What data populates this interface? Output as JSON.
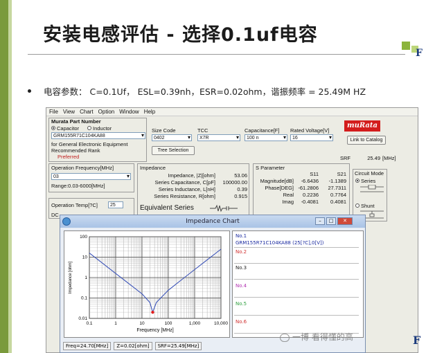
{
  "slide": {
    "title": "安装电感评估 - 选择0.1uf电容",
    "bullet": "电容参数：  C=0.1Uf， ESL=0.39nh，ESR=0.02ohm，谐振频率 = 25.49M HZ",
    "corner_logo": "F",
    "watermark": "一博  看得懂的高",
    "bottom_logo": "F"
  },
  "colors": {
    "accent_green": "#7a9a3c",
    "murata_red": "#d31c1c",
    "curve_blue": "#3a52b8",
    "marker_red": "#e02020"
  },
  "app": {
    "menu": [
      "File",
      "View",
      "Chart",
      "Option",
      "Window",
      "Help"
    ],
    "part_number": {
      "label": "Murata Part Number",
      "radio_capacitor": "Capacitor",
      "radio_inductor": "Inductor",
      "value": "GRM155R71C104KA88",
      "note1": "for General Electronic Equipment",
      "note2": "Recommended Rank",
      "note3": "Preferred"
    },
    "size_code": {
      "label": "Size Code",
      "value": "0402"
    },
    "tcc": {
      "label": "TCC",
      "value": "X7R"
    },
    "capacitance": {
      "label": "Capacitance[F]",
      "value": "100 n"
    },
    "rated_voltage": {
      "label": "Rated Voltage[V]",
      "value": "16"
    },
    "tree_button": "Tree Selection",
    "catalog_button": "Link to Catalog",
    "brand_logo": "muRata",
    "srf": {
      "label": "SRF",
      "value": "25.49",
      "unit": "[MHz]"
    },
    "operation_frequency": {
      "label": "Operation Frequency[MHz]",
      "value": "03",
      "range": "Range:0.03-6000[MHz]"
    },
    "operation_temp": {
      "label": "Operation Temp[?C]",
      "value": "25"
    },
    "dc_label": "DC",
    "impedance": {
      "label": "Impedance",
      "rows": [
        {
          "name": "Impedance, |Z|[ohm]",
          "value": "53.06"
        },
        {
          "name": "Series Capacitance, C[pF]",
          "value": "100000.00"
        },
        {
          "name": "Series Inductance, L[nH]",
          "value": "0.39"
        },
        {
          "name": "Series Resistance, R[ohm]",
          "value": "0.915"
        }
      ],
      "equivalent": "Equivalent Series"
    },
    "sparam": {
      "label": "S Parameter",
      "col1": "S11",
      "col2": "S21",
      "rows": [
        {
          "name": "Magnitude[dB]",
          "s11": "-6.6436",
          "s21": "-1.1389"
        },
        {
          "name": "Phase[DEG]",
          "s11": "-61.2806",
          "s21": "27.7311"
        },
        {
          "name": "Real",
          "s11": "0.2236",
          "s21": "0.7764"
        },
        {
          "name": "Imag",
          "s11": "-0.4081",
          "s21": "0.4081"
        }
      ]
    },
    "circuit_mode": {
      "label": "Circuit Mode",
      "series": "Series",
      "shunt": "Shunt"
    }
  },
  "impedance_chart": {
    "window_title": "Impedance Chart",
    "slots": [
      {
        "label": "No.1",
        "detail": "GRM155R71C104KA88 (25[?C],0[V])",
        "color": "#1a2aa0"
      },
      {
        "label": "No.2",
        "detail": "",
        "color": "#d03030"
      },
      {
        "label": "No.3",
        "detail": "",
        "color": "#222222"
      },
      {
        "label": "No.4",
        "detail": "",
        "color": "#b030b0"
      },
      {
        "label": "No.5",
        "detail": "",
        "color": "#30a040"
      },
      {
        "label": "No.6",
        "detail": "",
        "color": "#d03030"
      }
    ],
    "status": [
      "Freq=24.70[MHz]",
      "Z=0.02[ohm]",
      "SRF=25.49[MHz]"
    ]
  },
  "chart_data": {
    "type": "line",
    "xlabel": "Frequency [MHz]",
    "ylabel": "Impedance [ohm]",
    "xscale": "log",
    "yscale": "log",
    "xlim": [
      0.1,
      10000
    ],
    "ylim": [
      0.01,
      100
    ],
    "x_ticks": [
      "0.1",
      "1",
      "10",
      "100",
      "1,000",
      "10,000"
    ],
    "y_ticks": [
      "100",
      "10",
      "1",
      "0.1",
      "0.01"
    ],
    "grid": true,
    "series": [
      {
        "x": [
          0.1,
          0.3,
          1,
          3,
          10,
          20,
          25.49,
          35,
          100,
          300,
          1000,
          3000,
          10000
        ],
        "y": [
          15.9,
          5.3,
          1.59,
          0.53,
          0.16,
          0.06,
          0.02,
          0.06,
          0.24,
          0.73,
          2.45,
          7.35,
          24.5
        ]
      }
    ],
    "marker": {
      "x": 25.49,
      "y": 0.02
    }
  }
}
